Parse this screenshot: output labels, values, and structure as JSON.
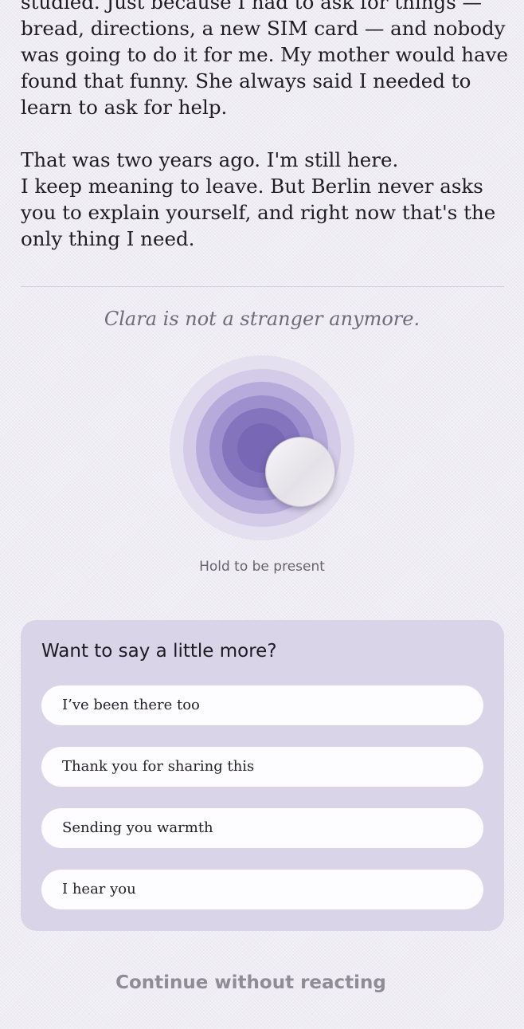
{
  "story": {
    "lines": [
      "studied. Just because I had to ask for things —",
      "bread, directions, a new SIM card — and nobody",
      "was going to do it for me. My mother would have",
      "found that funny. She always said I needed to",
      "learn to ask for help.",
      "That was two years ago. I'm still here.",
      "I keep meaning to leave. But Berlin never asks",
      "you to explain yourself, and right now that's the",
      "only thing I need."
    ]
  },
  "status_note": "Clara is not a stranger anymore.",
  "presence": {
    "hold_label": "Hold to be present"
  },
  "reply_card": {
    "title": "Want to say a little more?",
    "options": [
      "I’ve been there too",
      "Thank you for sharing this",
      "Sending you warmth",
      "I hear you"
    ]
  },
  "continue_label": "Continue without reacting",
  "colors": {
    "background": "#efedf4",
    "ring_core": "#6f5fae",
    "card_background": "#d9d4e8",
    "reply_background": "#fdfcfe",
    "muted_text": "#908c96"
  }
}
